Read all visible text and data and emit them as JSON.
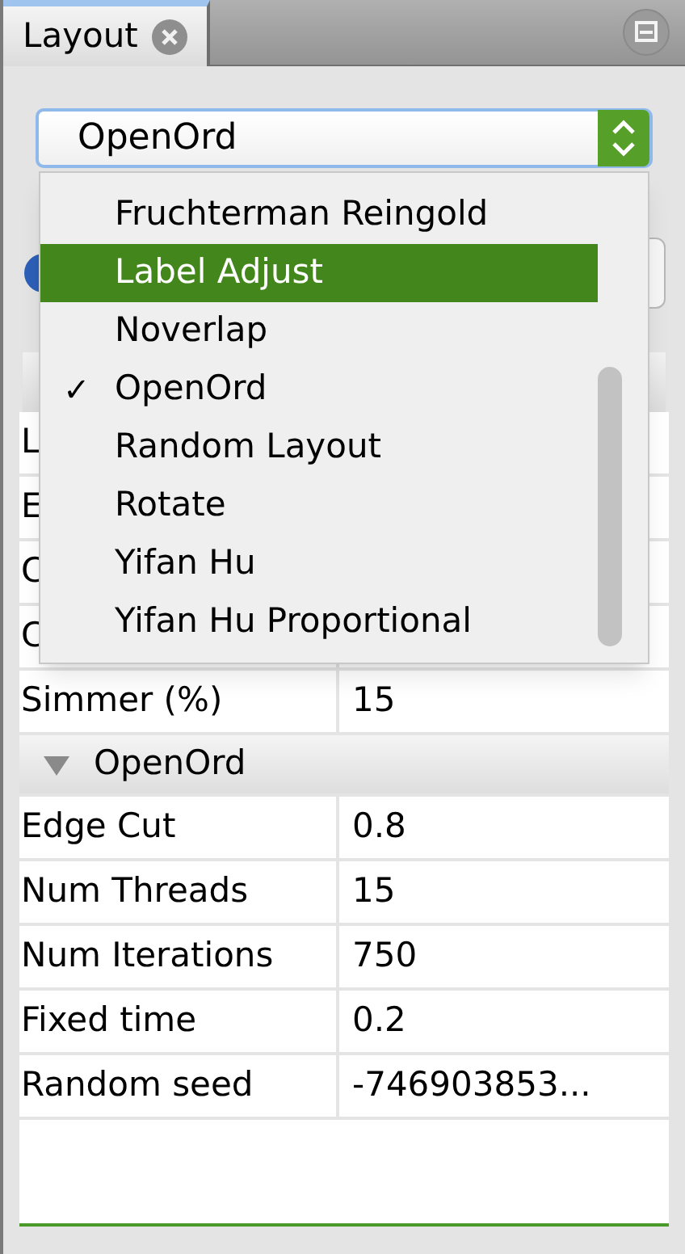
{
  "tab": {
    "title": "Layout"
  },
  "layout_select": {
    "value": "OpenOrd",
    "expanded": true
  },
  "dropdown": {
    "items": [
      {
        "label": "Fruchterman Reingold",
        "selected": false,
        "checked": false
      },
      {
        "label": "Label Adjust",
        "selected": true,
        "checked": false
      },
      {
        "label": "Noverlap",
        "selected": false,
        "checked": false
      },
      {
        "label": "OpenOrd",
        "selected": false,
        "checked": true
      },
      {
        "label": "Random Layout",
        "selected": false,
        "checked": false
      },
      {
        "label": "Rotate",
        "selected": false,
        "checked": false
      },
      {
        "label": "Yifan Hu",
        "selected": false,
        "checked": false
      },
      {
        "label": "Yifan Hu Proportional",
        "selected": false,
        "checked": false
      }
    ],
    "check_mark": "✓"
  },
  "properties": {
    "rows": [
      {
        "label": "L"
      },
      {
        "label": "E"
      },
      {
        "label": "C"
      },
      {
        "label": "C"
      },
      {
        "label": "Simmer (%)",
        "value": "15"
      }
    ],
    "sections": [
      {
        "title": "OpenOrd",
        "expanded": true,
        "rows": [
          {
            "label": "Edge Cut",
            "value": "0.8"
          },
          {
            "label": "Num Threads",
            "value": "15"
          },
          {
            "label": "Num Iterations",
            "value": "750"
          },
          {
            "label": "Fixed time",
            "value": "0.2"
          },
          {
            "label": "Random seed",
            "value": "-746903853..."
          }
        ]
      }
    ]
  }
}
